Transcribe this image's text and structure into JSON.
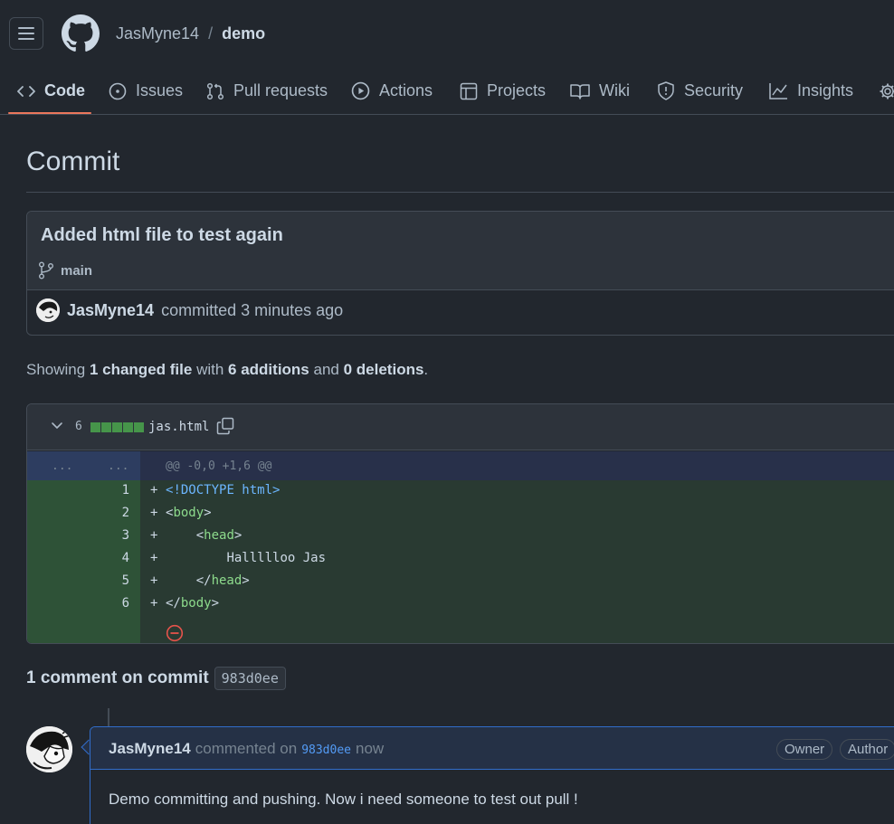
{
  "header": {
    "owner": "JasMyne14",
    "separator": "/",
    "repo": "demo"
  },
  "tabs": [
    {
      "label": "Code",
      "icon": "code-icon",
      "selected": true
    },
    {
      "label": "Issues",
      "icon": "issue-opened-icon"
    },
    {
      "label": "Pull requests",
      "icon": "git-pull-request-icon"
    },
    {
      "label": "Actions",
      "icon": "play-icon"
    },
    {
      "label": "Projects",
      "icon": "table-icon"
    },
    {
      "label": "Wiki",
      "icon": "book-icon"
    },
    {
      "label": "Security",
      "icon": "shield-icon"
    },
    {
      "label": "Insights",
      "icon": "graph-icon"
    },
    {
      "label": "",
      "icon": "gear-icon"
    }
  ],
  "page": {
    "title": "Commit"
  },
  "commit": {
    "message": "Added html file to test again",
    "branch": "main",
    "author": "JasMyne14",
    "action": "committed 3 minutes ago"
  },
  "summary": {
    "prefix": "Showing",
    "files": "1 changed file",
    "with": "with",
    "additions": "6 additions",
    "and": "and",
    "deletions": "0 deletions",
    "suffix": "."
  },
  "diff": {
    "count": "6",
    "filename": "jas.html",
    "hunk_left": "...",
    "hunk_right": "...",
    "hunk_header": "@@ -0,0 +1,6 @@",
    "lines": [
      {
        "num": "1",
        "sign": "+",
        "indent": "",
        "open": "<",
        "tag": "!DOCTYPE html",
        "close": ">",
        "text": ""
      },
      {
        "num": "2",
        "sign": "+",
        "indent": "",
        "open": "<",
        "tag": "body",
        "close": ">",
        "text": ""
      },
      {
        "num": "3",
        "sign": "+",
        "indent": "    ",
        "open": "<",
        "tag": "head",
        "close": ">",
        "text": ""
      },
      {
        "num": "4",
        "sign": "+",
        "indent": "        ",
        "open": "",
        "tag": "",
        "close": "",
        "text": "Hallllloo Jas"
      },
      {
        "num": "5",
        "sign": "+",
        "indent": "    ",
        "open": "</",
        "tag": "head",
        "close": ">",
        "text": ""
      },
      {
        "num": "6",
        "sign": "+",
        "indent": "",
        "open": "</",
        "tag": "body",
        "close": ">",
        "text": ""
      }
    ]
  },
  "comments": {
    "title": "1 comment on commit",
    "sha": "983d0ee",
    "items": [
      {
        "author": "JasMyne14",
        "verb": "commented on",
        "sha": "983d0ee",
        "when": "now",
        "badges": [
          "Owner",
          "Author"
        ],
        "body": "Demo committing and pushing. Now i need someone to test out pull !"
      }
    ]
  },
  "colors": {
    "background": "#22272e",
    "addition": "#293a32",
    "addition_gutter": "#2e5237",
    "hunk": "#28304a",
    "accent_underline": "#ec775c",
    "link": "#539bf5"
  }
}
